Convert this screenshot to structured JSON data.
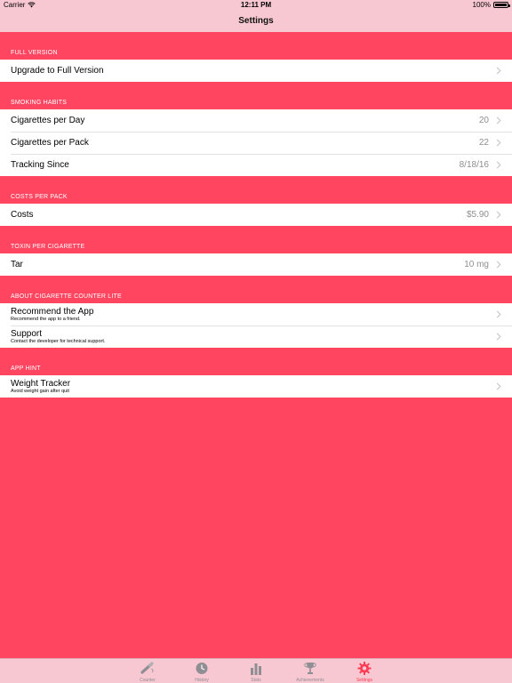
{
  "status_bar": {
    "carrier": "Carrier",
    "time": "12:11 PM",
    "battery": "100%"
  },
  "nav": {
    "title": "Settings"
  },
  "sections": [
    {
      "header": "FULL VERSION",
      "rows": [
        {
          "label": "Upgrade to Full Version",
          "value": ""
        }
      ]
    },
    {
      "header": "SMOKING HABITS",
      "rows": [
        {
          "label": "Cigarettes per Day",
          "value": "20"
        },
        {
          "label": "Cigarettes per Pack",
          "value": "22"
        },
        {
          "label": "Tracking Since",
          "value": "8/18/16"
        }
      ]
    },
    {
      "header": "COSTS PER PACK",
      "rows": [
        {
          "label": "Costs",
          "value": "$5.90"
        }
      ]
    },
    {
      "header": "TOXIN PER CIGARETTE",
      "rows": [
        {
          "label": "Tar",
          "value": "10 mg"
        }
      ]
    },
    {
      "header": "ABOUT CIGARETTE COUNTER LITE",
      "rows": [
        {
          "label": "Recommend the App",
          "sub": "Recommend the app to a friend."
        },
        {
          "label": "Support",
          "sub": "Contact the developer for technical support."
        }
      ]
    },
    {
      "header": "APP HINT",
      "rows": [
        {
          "label": "Weight Tracker",
          "sub": "Avoid weight gain after quit"
        }
      ]
    }
  ],
  "tabs": [
    {
      "label": "Counter",
      "icon": "cigarette-icon"
    },
    {
      "label": "History",
      "icon": "clock-icon"
    },
    {
      "label": "Stats",
      "icon": "bar-chart-icon"
    },
    {
      "label": "Achievements",
      "icon": "trophy-icon"
    },
    {
      "label": "Settings",
      "icon": "gear-icon",
      "active": true
    }
  ],
  "colors": {
    "accent": "#ff4560",
    "bar": "#f8c8d2",
    "active_tab": "#ff3b55",
    "inactive_tab": "#8e8e93"
  }
}
